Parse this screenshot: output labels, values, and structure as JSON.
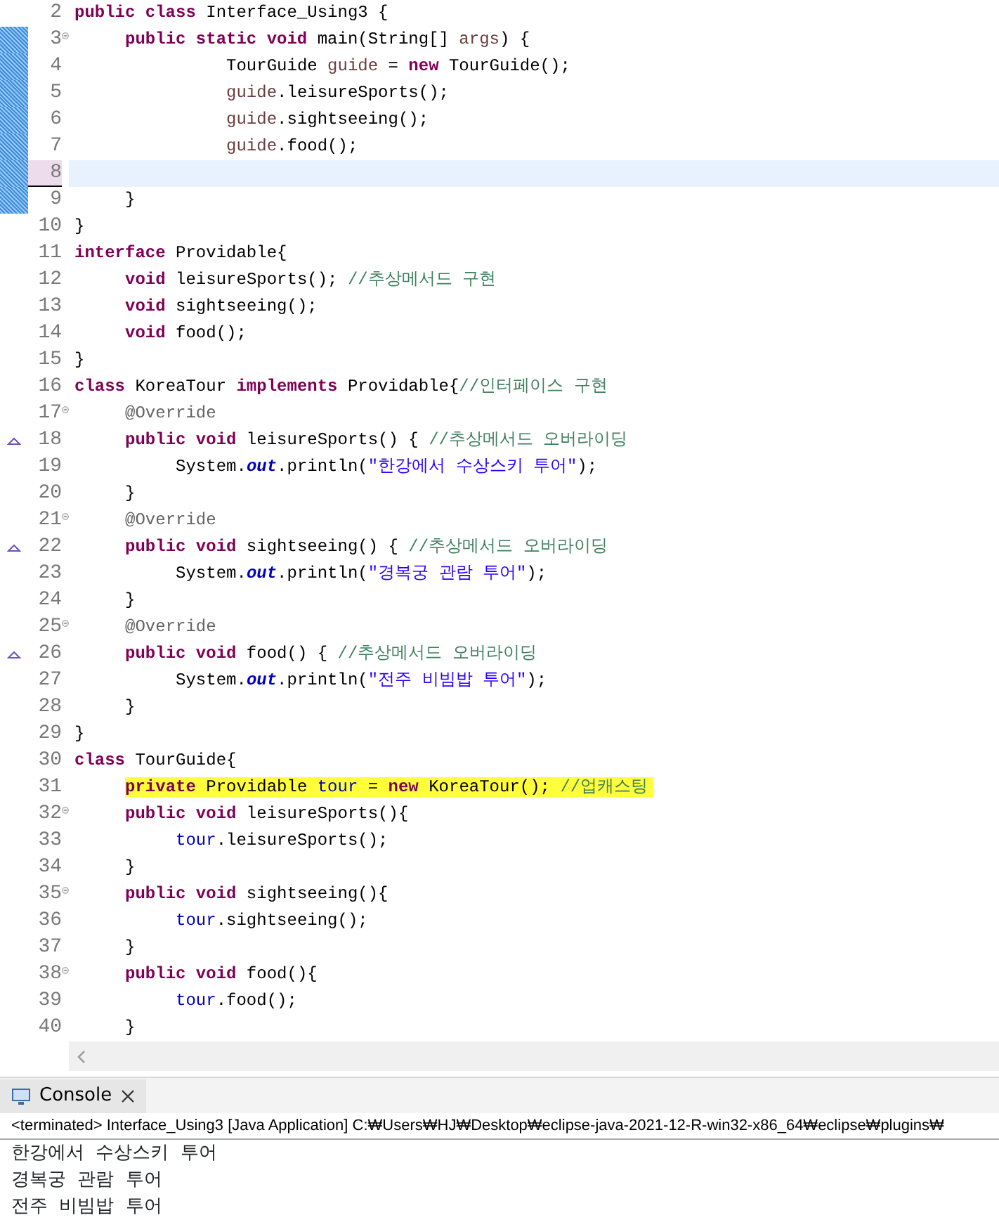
{
  "editor": {
    "lines": [
      {
        "number": "2",
        "kind": "plain",
        "changed": false,
        "current": false,
        "highlighted": false,
        "tokens": [
          {
            "kind": "k",
            "text": "public class"
          },
          {
            "kind": "p",
            "text": " Interface_Using3 {"
          }
        ]
      },
      {
        "number": "3",
        "kind": "fold",
        "changed": true,
        "current": false,
        "highlighted": false,
        "tokens": [
          {
            "kind": "k",
            "text": "\tpublic static void"
          },
          {
            "kind": "p",
            "text": " main(String[] "
          },
          {
            "kind": "v",
            "text": "args"
          },
          {
            "kind": "p",
            "text": ") {"
          }
        ]
      },
      {
        "number": "4",
        "kind": "plain",
        "changed": true,
        "current": false,
        "highlighted": false,
        "tokens": [
          {
            "kind": "p",
            "text": "\t\t\tTourGuide "
          },
          {
            "kind": "v",
            "text": "guide"
          },
          {
            "kind": "p",
            "text": " = "
          },
          {
            "kind": "k",
            "text": "new"
          },
          {
            "kind": "p",
            "text": " TourGuide();"
          }
        ]
      },
      {
        "number": "5",
        "kind": "plain",
        "changed": true,
        "current": false,
        "highlighted": false,
        "tokens": [
          {
            "kind": "v",
            "text": "\t\t\tguide"
          },
          {
            "kind": "p",
            "text": ".leisureSports();"
          }
        ]
      },
      {
        "number": "6",
        "kind": "plain",
        "changed": true,
        "current": false,
        "highlighted": false,
        "tokens": [
          {
            "kind": "v",
            "text": "\t\t\tguide"
          },
          {
            "kind": "p",
            "text": ".sightseeing();"
          }
        ]
      },
      {
        "number": "7",
        "kind": "plain",
        "changed": true,
        "current": false,
        "highlighted": false,
        "tokens": [
          {
            "kind": "v",
            "text": "\t\t\tguide"
          },
          {
            "kind": "p",
            "text": ".food();"
          }
        ]
      },
      {
        "number": "8",
        "kind": "plain",
        "changed": true,
        "current": true,
        "highlighted": false
      },
      {
        "number": "9",
        "kind": "plain",
        "changed": true,
        "current": false,
        "highlighted": false,
        "tokens": [
          {
            "kind": "p",
            "text": "\t}"
          }
        ]
      },
      {
        "number": "10",
        "kind": "plain",
        "changed": false,
        "current": false,
        "highlighted": false,
        "tokens": [
          {
            "kind": "p",
            "text": "}"
          }
        ]
      },
      {
        "number": "11",
        "kind": "plain",
        "changed": false,
        "current": false,
        "highlighted": false,
        "tokens": [
          {
            "kind": "k",
            "text": "interface"
          },
          {
            "kind": "p",
            "text": " Providable{"
          }
        ]
      },
      {
        "number": "12",
        "kind": "plain",
        "changed": false,
        "current": false,
        "highlighted": false,
        "tokens": [
          {
            "kind": "k",
            "text": "\tvoid"
          },
          {
            "kind": "p",
            "text": " leisureSports(); "
          },
          {
            "kind": "c",
            "text": "//추상메서드 구현"
          }
        ]
      },
      {
        "number": "13",
        "kind": "plain",
        "changed": false,
        "current": false,
        "highlighted": false,
        "tokens": [
          {
            "kind": "k",
            "text": "\tvoid"
          },
          {
            "kind": "p",
            "text": " sightseeing();"
          }
        ]
      },
      {
        "number": "14",
        "kind": "plain",
        "changed": false,
        "current": false,
        "highlighted": false,
        "tokens": [
          {
            "kind": "k",
            "text": "\tvoid"
          },
          {
            "kind": "p",
            "text": " food();"
          }
        ]
      },
      {
        "number": "15",
        "kind": "plain",
        "changed": false,
        "current": false,
        "highlighted": false,
        "tokens": [
          {
            "kind": "p",
            "text": "}"
          }
        ]
      },
      {
        "number": "16",
        "kind": "plain",
        "changed": false,
        "current": false,
        "highlighted": false,
        "tokens": [
          {
            "kind": "k",
            "text": "class"
          },
          {
            "kind": "p",
            "text": " KoreaTour "
          },
          {
            "kind": "k",
            "text": "implements"
          },
          {
            "kind": "p",
            "text": " Providable{"
          },
          {
            "kind": "c",
            "text": "//인터페이스 구현"
          }
        ]
      },
      {
        "number": "17",
        "kind": "fold",
        "changed": false,
        "current": false,
        "highlighted": false,
        "tokens": [
          {
            "kind": "a",
            "text": "\t@Override"
          }
        ]
      },
      {
        "number": "18",
        "kind": "override",
        "changed": false,
        "current": false,
        "highlighted": false,
        "tokens": [
          {
            "kind": "k",
            "text": "\tpublic void"
          },
          {
            "kind": "p",
            "text": " leisureSports() { "
          },
          {
            "kind": "c",
            "text": "//추상메서드 오버라이딩"
          }
        ]
      },
      {
        "number": "19",
        "kind": "plain",
        "changed": false,
        "current": false,
        "highlighted": false,
        "tokens": [
          {
            "kind": "p",
            "text": "\t\tSystem."
          },
          {
            "kind": "s",
            "text": "out"
          },
          {
            "kind": "p",
            "text": ".println("
          },
          {
            "kind": "str",
            "text": "\"한강에서 수상스키 투어\""
          },
          {
            "kind": "p",
            "text": ");"
          }
        ]
      },
      {
        "number": "20",
        "kind": "plain",
        "changed": false,
        "current": false,
        "highlighted": false,
        "tokens": [
          {
            "kind": "p",
            "text": "\t}"
          }
        ]
      },
      {
        "number": "21",
        "kind": "fold",
        "changed": false,
        "current": false,
        "highlighted": false,
        "tokens": [
          {
            "kind": "a",
            "text": "\t@Override"
          }
        ]
      },
      {
        "number": "22",
        "kind": "override",
        "changed": false,
        "current": false,
        "highlighted": false,
        "tokens": [
          {
            "kind": "k",
            "text": "\tpublic void"
          },
          {
            "kind": "p",
            "text": " sightseeing() { "
          },
          {
            "kind": "c",
            "text": "//추상메서드 오버라이딩"
          }
        ]
      },
      {
        "number": "23",
        "kind": "plain",
        "changed": false,
        "current": false,
        "highlighted": false,
        "tokens": [
          {
            "kind": "p",
            "text": "\t\tSystem."
          },
          {
            "kind": "s",
            "text": "out"
          },
          {
            "kind": "p",
            "text": ".println("
          },
          {
            "kind": "str",
            "text": "\"경복궁 관람 투어\""
          },
          {
            "kind": "p",
            "text": ");"
          }
        ]
      },
      {
        "number": "24",
        "kind": "plain",
        "changed": false,
        "current": false,
        "highlighted": false,
        "tokens": [
          {
            "kind": "p",
            "text": "\t}"
          }
        ]
      },
      {
        "number": "25",
        "kind": "fold",
        "changed": false,
        "current": false,
        "highlighted": false,
        "tokens": [
          {
            "kind": "a",
            "text": "\t@Override"
          }
        ]
      },
      {
        "number": "26",
        "kind": "override",
        "changed": false,
        "current": false,
        "highlighted": false,
        "tokens": [
          {
            "kind": "k",
            "text": "\tpublic void"
          },
          {
            "kind": "p",
            "text": " food() { "
          },
          {
            "kind": "c",
            "text": "//추상메서드 오버라이딩"
          }
        ]
      },
      {
        "number": "27",
        "kind": "plain",
        "changed": false,
        "current": false,
        "highlighted": false,
        "tokens": [
          {
            "kind": "p",
            "text": "\t\tSystem."
          },
          {
            "kind": "s",
            "text": "out"
          },
          {
            "kind": "p",
            "text": ".println("
          },
          {
            "kind": "str",
            "text": "\"전주 비빔밥 투어\""
          },
          {
            "kind": "p",
            "text": ");"
          }
        ]
      },
      {
        "number": "28",
        "kind": "plain",
        "changed": false,
        "current": false,
        "highlighted": false,
        "tokens": [
          {
            "kind": "p",
            "text": "\t}"
          }
        ]
      },
      {
        "number": "29",
        "kind": "plain",
        "changed": false,
        "current": false,
        "highlighted": false,
        "tokens": [
          {
            "kind": "p",
            "text": "}"
          }
        ]
      },
      {
        "number": "30",
        "kind": "plain",
        "changed": false,
        "current": false,
        "highlighted": false,
        "tokens": [
          {
            "kind": "k",
            "text": "class"
          },
          {
            "kind": "p",
            "text": " TourGuide{"
          }
        ]
      },
      {
        "number": "31",
        "kind": "plain",
        "changed": false,
        "current": false,
        "highlighted": true,
        "tokens": [
          {
            "kind": "k",
            "text": "\tprivate"
          },
          {
            "kind": "p",
            "text": " Providable "
          },
          {
            "kind": "f",
            "text": "tour"
          },
          {
            "kind": "p",
            "text": " = "
          },
          {
            "kind": "k",
            "text": "new"
          },
          {
            "kind": "p",
            "text": " KoreaTour(); "
          },
          {
            "kind": "c",
            "text": "//업캐스팅"
          }
        ]
      },
      {
        "number": "32",
        "kind": "fold",
        "changed": false,
        "current": false,
        "highlighted": false,
        "tokens": [
          {
            "kind": "k",
            "text": "\tpublic void"
          },
          {
            "kind": "p",
            "text": " leisureSports(){"
          }
        ]
      },
      {
        "number": "33",
        "kind": "plain",
        "changed": false,
        "current": false,
        "highlighted": false,
        "tokens": [
          {
            "kind": "f",
            "text": "\t\ttour"
          },
          {
            "kind": "p",
            "text": ".leisureSports();"
          }
        ]
      },
      {
        "number": "34",
        "kind": "plain",
        "changed": false,
        "current": false,
        "highlighted": false,
        "tokens": [
          {
            "kind": "p",
            "text": "\t}"
          }
        ]
      },
      {
        "number": "35",
        "kind": "fold",
        "changed": false,
        "current": false,
        "highlighted": false,
        "tokens": [
          {
            "kind": "k",
            "text": "\tpublic void"
          },
          {
            "kind": "p",
            "text": " sightseeing(){"
          }
        ]
      },
      {
        "number": "36",
        "kind": "plain",
        "changed": false,
        "current": false,
        "highlighted": false,
        "tokens": [
          {
            "kind": "f",
            "text": "\t\ttour"
          },
          {
            "kind": "p",
            "text": ".sightseeing();"
          }
        ]
      },
      {
        "number": "37",
        "kind": "plain",
        "changed": false,
        "current": false,
        "highlighted": false,
        "tokens": [
          {
            "kind": "p",
            "text": "\t}"
          }
        ]
      },
      {
        "number": "38",
        "kind": "fold",
        "changed": false,
        "current": false,
        "highlighted": false,
        "tokens": [
          {
            "kind": "k",
            "text": "\tpublic void"
          },
          {
            "kind": "p",
            "text": " food(){"
          }
        ]
      },
      {
        "number": "39",
        "kind": "plain",
        "changed": false,
        "current": false,
        "highlighted": false,
        "tokens": [
          {
            "kind": "f",
            "text": "\t\ttour"
          },
          {
            "kind": "p",
            "text": ".food();"
          }
        ]
      },
      {
        "number": "40",
        "kind": "plain",
        "changed": false,
        "current": false,
        "highlighted": false,
        "tokens": [
          {
            "kind": "p",
            "text": "\t}"
          }
        ]
      }
    ]
  },
  "console": {
    "tab": {
      "label": "Console",
      "selected": true
    },
    "header": "<terminated> Interface_Using3 [Java Application] C:₩Users₩HJ₩Desktop₩eclipse-java-2021-12-R-win32-x86_64₩eclipse₩plugins₩",
    "output": [
      "한강에서 수상스키 투어",
      "경복궁 관람 투어",
      "전주 비빔밥 투어"
    ]
  }
}
